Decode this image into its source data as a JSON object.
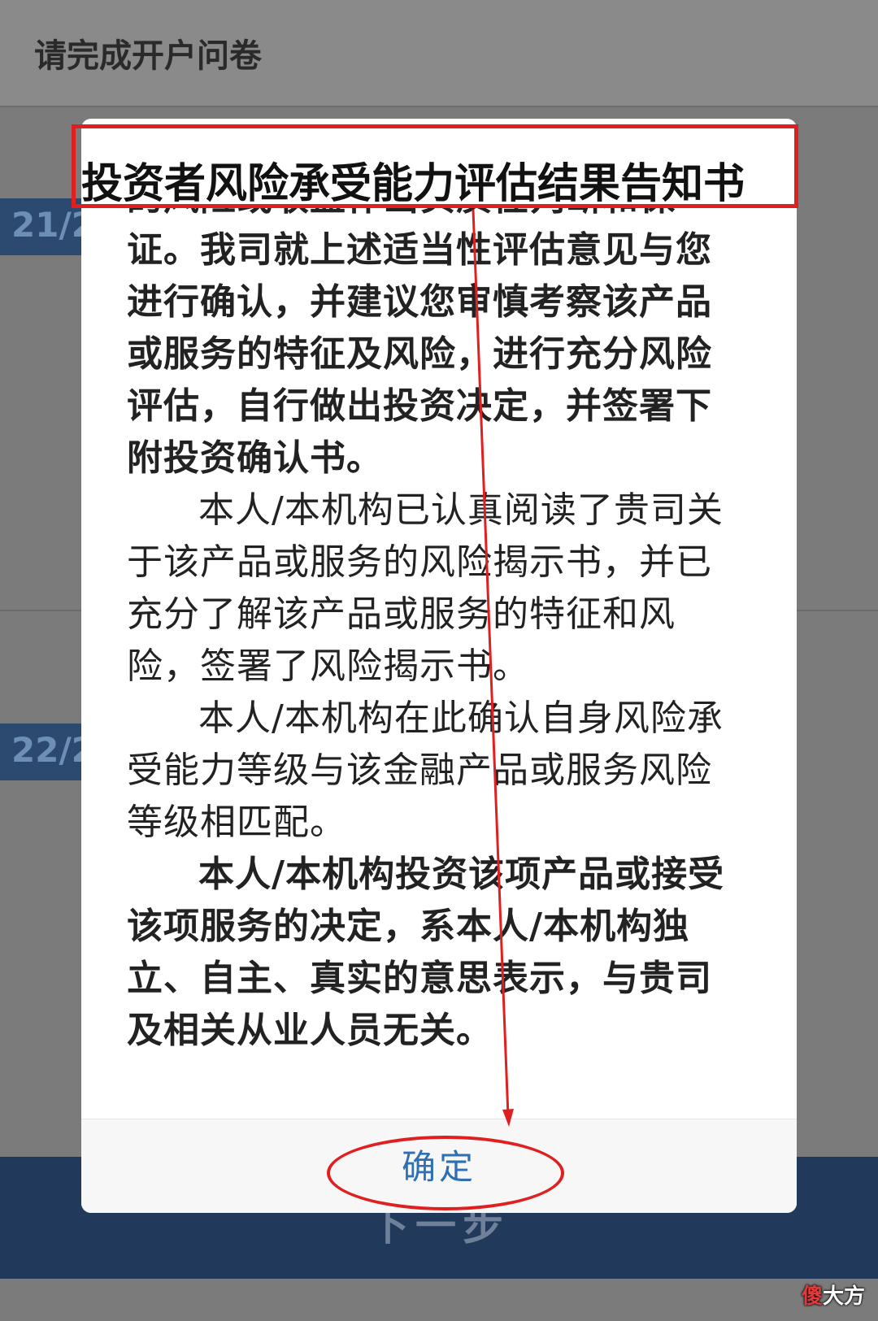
{
  "page": {
    "header_title": "请完成开户问卷",
    "question_badges": [
      "21/2",
      "22/2"
    ],
    "next_button_label": "下一步"
  },
  "modal": {
    "title": "投资者风险承受能力评估结果告知书",
    "paragraphs": [
      "的风险或收益作出实质性判断和保证。我司就上述适当性评估意见与您进行确认，并建议您审慎考察该产品或服务的特征及风险，进行充分风险评估，自行做出投资决定，并签署下附投资确认书。",
      "本人/本机构已认真阅读了贵司关于该产品或服务的风险揭示书，并已充分了解该产品或服务的特征和风险，签署了风险揭示书。",
      "本人/本机构在此确认自身风险承受能力等级与该金融产品或服务风险等级相匹配。",
      "本人/本机构投资该项产品或接受该项服务的决定，系本人/本机构独立、自主、真实的意思表示，与贵司及相关从业人员无关。"
    ],
    "confirm_label": "确定"
  },
  "annotation_colors": {
    "highlight": "#e02020"
  },
  "watermark": {
    "prefix": "傻",
    "suffix": "大方"
  }
}
